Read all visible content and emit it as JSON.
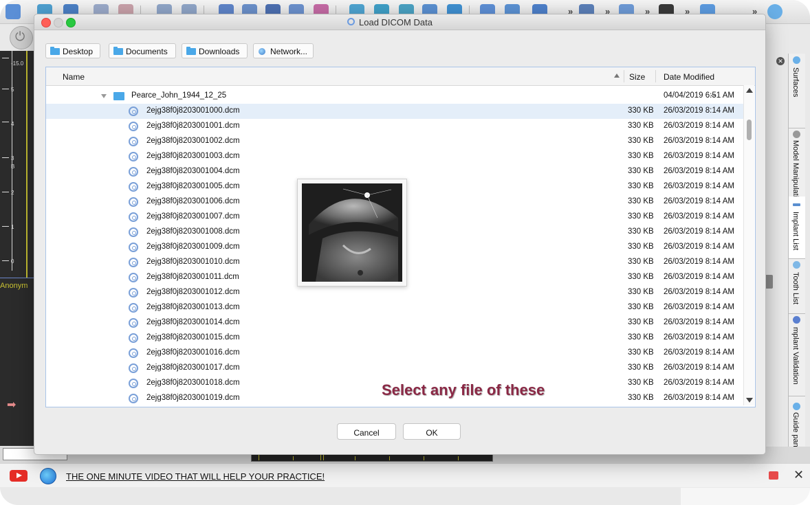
{
  "dialog": {
    "title": "Load DICOM Data",
    "sidebar": [
      {
        "label": "Desktop",
        "icon": "folder-icon"
      },
      {
        "label": "Documents",
        "icon": "folder-icon"
      },
      {
        "label": "Downloads",
        "icon": "folder-icon"
      },
      {
        "label": "Network...",
        "icon": "network-globe-icon"
      }
    ],
    "columns": {
      "name": "Name",
      "size": "Size",
      "date": "Date Modified"
    },
    "folder": {
      "name": "Pearce_John_1944_12_25",
      "size": "--",
      "date": "04/04/2019 6:51 AM"
    },
    "files": [
      {
        "name": "2ejg38f0j8203001000.dcm",
        "size": "330 KB",
        "date": "26/03/2019 8:14 AM"
      },
      {
        "name": "2ejg38f0j8203001001.dcm",
        "size": "330 KB",
        "date": "26/03/2019 8:14 AM"
      },
      {
        "name": "2ejg38f0j8203001002.dcm",
        "size": "330 KB",
        "date": "26/03/2019 8:14 AM"
      },
      {
        "name": "2ejg38f0j8203001003.dcm",
        "size": "330 KB",
        "date": "26/03/2019 8:14 AM"
      },
      {
        "name": "2ejg38f0j8203001004.dcm",
        "size": "330 KB",
        "date": "26/03/2019 8:14 AM"
      },
      {
        "name": "2ejg38f0j8203001005.dcm",
        "size": "330 KB",
        "date": "26/03/2019 8:14 AM"
      },
      {
        "name": "2ejg38f0j8203001006.dcm",
        "size": "330 KB",
        "date": "26/03/2019 8:14 AM"
      },
      {
        "name": "2ejg38f0j8203001007.dcm",
        "size": "330 KB",
        "date": "26/03/2019 8:14 AM"
      },
      {
        "name": "2ejg38f0j8203001008.dcm",
        "size": "330 KB",
        "date": "26/03/2019 8:14 AM"
      },
      {
        "name": "2ejg38f0j8203001009.dcm",
        "size": "330 KB",
        "date": "26/03/2019 8:14 AM"
      },
      {
        "name": "2ejg38f0j8203001010.dcm",
        "size": "330 KB",
        "date": "26/03/2019 8:14 AM"
      },
      {
        "name": "2ejg38f0j8203001011.dcm",
        "size": "330 KB",
        "date": "26/03/2019 8:14 AM"
      },
      {
        "name": "2ejg38f0j8203001012.dcm",
        "size": "330 KB",
        "date": "26/03/2019 8:14 AM"
      },
      {
        "name": "2ejg38f0j8203001013.dcm",
        "size": "330 KB",
        "date": "26/03/2019 8:14 AM"
      },
      {
        "name": "2ejg38f0j8203001014.dcm",
        "size": "330 KB",
        "date": "26/03/2019 8:14 AM"
      },
      {
        "name": "2ejg38f0j8203001015.dcm",
        "size": "330 KB",
        "date": "26/03/2019 8:14 AM"
      },
      {
        "name": "2ejg38f0j8203001016.dcm",
        "size": "330 KB",
        "date": "26/03/2019 8:14 AM"
      },
      {
        "name": "2ejg38f0j8203001017.dcm",
        "size": "330 KB",
        "date": "26/03/2019 8:14 AM"
      },
      {
        "name": "2ejg38f0j8203001018.dcm",
        "size": "330 KB",
        "date": "26/03/2019 8:14 AM"
      },
      {
        "name": "2ejg38f0j8203001019.dcm",
        "size": "330 KB",
        "date": "26/03/2019 8:14 AM"
      }
    ],
    "annotation": "Select any file of these",
    "cancel_label": "Cancel",
    "ok_label": "OK"
  },
  "right_sidebar": {
    "tabs": [
      "Surfaces",
      "Model Manipulation",
      "Implant List",
      "Tooth List",
      "mplant Validation",
      "Guide panel"
    ]
  },
  "left_panel": {
    "scale_top": "-15.0",
    "scale_labels": [
      "5",
      "4",
      "3",
      "2",
      "1",
      "0"
    ],
    "marker": "B",
    "patient_label": "Anonym"
  },
  "ad_bar": {
    "text": "THE ONE MINUTE VIDEO THAT WILL HELP YOUR PRACTICE!"
  },
  "colors": {
    "annotation": "#8a2845",
    "selection": "#e4eef9",
    "folder": "#4aa8e8",
    "accent": "#6b9be0"
  }
}
